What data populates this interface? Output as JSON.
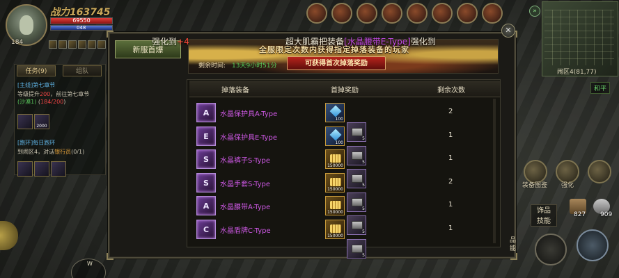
{
  "player": {
    "power_label": "战力163745",
    "hp": "69550",
    "mp_partial": "048",
    "level": "184",
    "hp_fraction": 1.0,
    "mp_fraction": 1.0
  },
  "quests": {
    "tab_task": "任务(9)",
    "tab_team": "组队",
    "main_title": "[主线]第七章节",
    "main_desc_a": "等级提升",
    "main_desc_lvl": "200",
    "main_desc_b": "，前往第七章节",
    "main_desc_c": "(沙漠1)",
    "main_desc_progress": "184/200",
    "reward1_qty": "",
    "reward2_qty": "2000",
    "daily_title": "[跑环]每日跑环",
    "daily_desc_a": "到闹区4，对话",
    "daily_desc_npc": "银行员",
    "daily_desc_b": "(0/1)"
  },
  "announcement": {
    "part1": "强化到",
    "part1_value": "+4",
    "part2": "超大肌霸把装备",
    "item": "[水晶腰带E-Type]",
    "part3": "强化到"
  },
  "dialog": {
    "side_tab": "新服首爆",
    "banner_title": "全服限定次数内获得指定掉落装备的玩家",
    "countdown_label": "剩余时间:",
    "countdown_value": "13天9小时51分",
    "banner_button": "可获得首次掉落奖励",
    "columns": [
      "掉落装备",
      "首掉奖励",
      "剩余次数"
    ],
    "close_label": "✕",
    "rows": [
      {
        "icon_letter": "A",
        "name": "水晶保护具A-Type",
        "reward_type": "gem",
        "reward_qty": "100",
        "box_qty": "5",
        "remaining": "2"
      },
      {
        "icon_letter": "E",
        "name": "水晶保护具E-Type",
        "reward_type": "gem",
        "reward_qty": "100",
        "box_qty": "5",
        "remaining": "1"
      },
      {
        "icon_letter": "S",
        "name": "水晶裤子S-Type",
        "reward_type": "gold",
        "reward_qty": "150000",
        "box_qty": "5",
        "remaining": "1"
      },
      {
        "icon_letter": "S",
        "name": "水晶手套S-Type",
        "reward_type": "gold",
        "reward_qty": "150000",
        "box_qty": "5",
        "remaining": "2"
      },
      {
        "icon_letter": "A",
        "name": "水晶腰带A-Type",
        "reward_type": "gold",
        "reward_qty": "150000",
        "box_qty": "5",
        "remaining": "1"
      },
      {
        "icon_letter": "C",
        "name": "水晶盾牌C-Type",
        "reward_type": "gold",
        "reward_qty": "150000",
        "box_qty": "5",
        "remaining": "1"
      }
    ]
  },
  "right_hud": {
    "map_name": "闹区4(81,77)",
    "peace_mode": "和平",
    "equip_label": "装备图鉴",
    "enhance_label": "强化",
    "accessory_label_1": "饰品",
    "accessory_label_2": "技能",
    "bag1_count": "827",
    "bag2_count": "909",
    "partial_label_1": "品",
    "partial_label_2": "能"
  },
  "compass": {
    "north": "W"
  }
}
